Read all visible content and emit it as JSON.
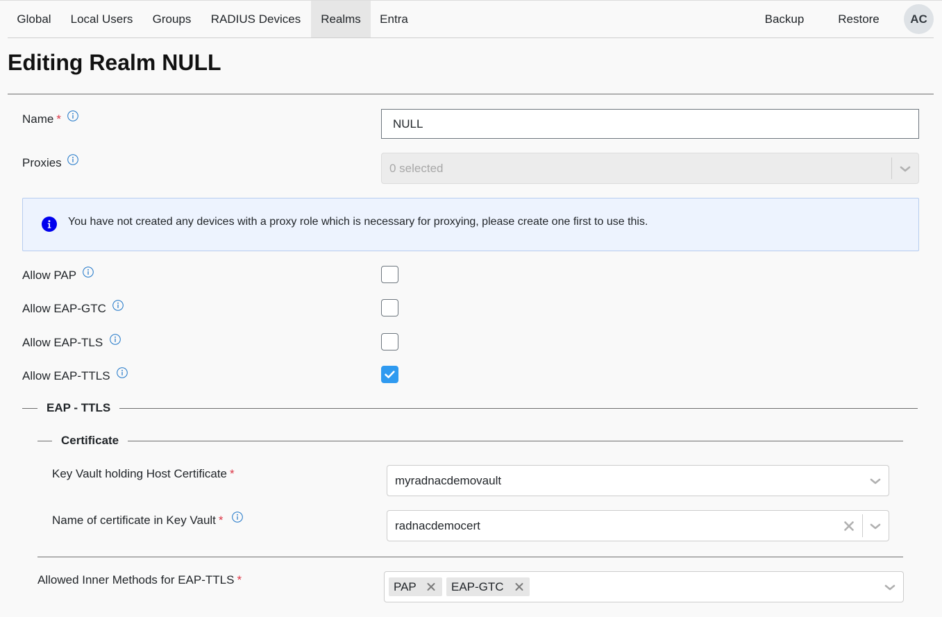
{
  "nav": {
    "items": [
      {
        "label": "Global"
      },
      {
        "label": "Local Users"
      },
      {
        "label": "Groups"
      },
      {
        "label": "RADIUS Devices"
      },
      {
        "label": "Realms",
        "active": true
      },
      {
        "label": "Entra"
      }
    ],
    "backup_label": "Backup",
    "restore_label": "Restore",
    "avatar_initials": "AC"
  },
  "page": {
    "title": "Editing Realm NULL"
  },
  "form": {
    "required_mark": "*",
    "name": {
      "label": "Name",
      "value": "NULL"
    },
    "proxies": {
      "label": "Proxies",
      "placeholder": "0 selected"
    },
    "proxy_alert": "You have not created any devices with a proxy role which is necessary for proxying, please create one first to use this.",
    "allow_pap": {
      "label": "Allow PAP",
      "checked": false
    },
    "allow_eap_gtc": {
      "label": "Allow EAP-GTC",
      "checked": false
    },
    "allow_eap_tls": {
      "label": "Allow EAP-TLS",
      "checked": false
    },
    "allow_eap_ttls": {
      "label": "Allow EAP-TTLS",
      "checked": true
    },
    "eap_ttls": {
      "legend": "EAP - TTLS",
      "certificate": {
        "legend": "Certificate",
        "key_vault": {
          "label": "Key Vault holding Host Certificate",
          "value": "myradnacdemovault"
        },
        "cert_name": {
          "label": "Name of certificate in Key Vault",
          "value": "radnacdemocert"
        }
      },
      "inner_methods": {
        "label": "Allowed Inner Methods for EAP-TTLS",
        "selected": [
          "PAP",
          "EAP-GTC"
        ]
      }
    }
  },
  "colors": {
    "accent": "#2f9af0",
    "required": "#dc3545",
    "info_icon": "#1a73c7",
    "alert_bg": "#edf3fe",
    "alert_icon": "#0000ee"
  }
}
